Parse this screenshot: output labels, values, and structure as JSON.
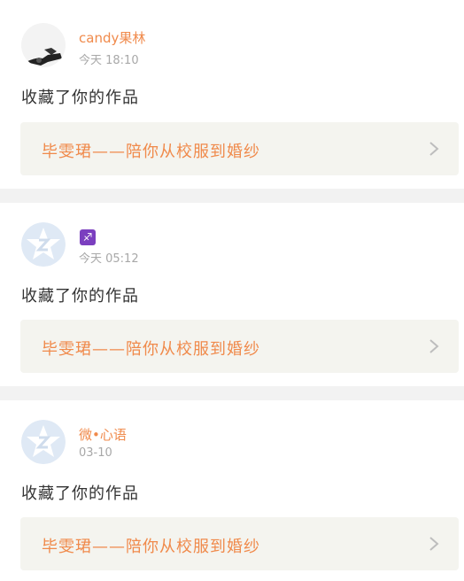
{
  "feed": [
    {
      "user": "candy果林",
      "badge": "",
      "time": "今天 18:10",
      "action": "收藏了你的作品",
      "work": "毕雯珺——陪你从校服到婚纱"
    },
    {
      "user": "",
      "badge": "♐",
      "time": "今天 05:12",
      "action": "收藏了你的作品",
      "work": "毕雯珺——陪你从校服到婚纱"
    },
    {
      "user": "微•心语",
      "badge": "",
      "time": "03-10",
      "action": "收藏了你的作品",
      "work": "毕雯珺——陪你从校服到婚纱"
    }
  ],
  "colors": {
    "accent": "#f08a4b",
    "card_bg": "#f4f4ef",
    "separator": "#f2f2f2",
    "badge": "#7b3fbf"
  },
  "icons": {
    "default_avatar": "qzone-star-avatar-icon",
    "chevron": "chevron-right-icon"
  }
}
